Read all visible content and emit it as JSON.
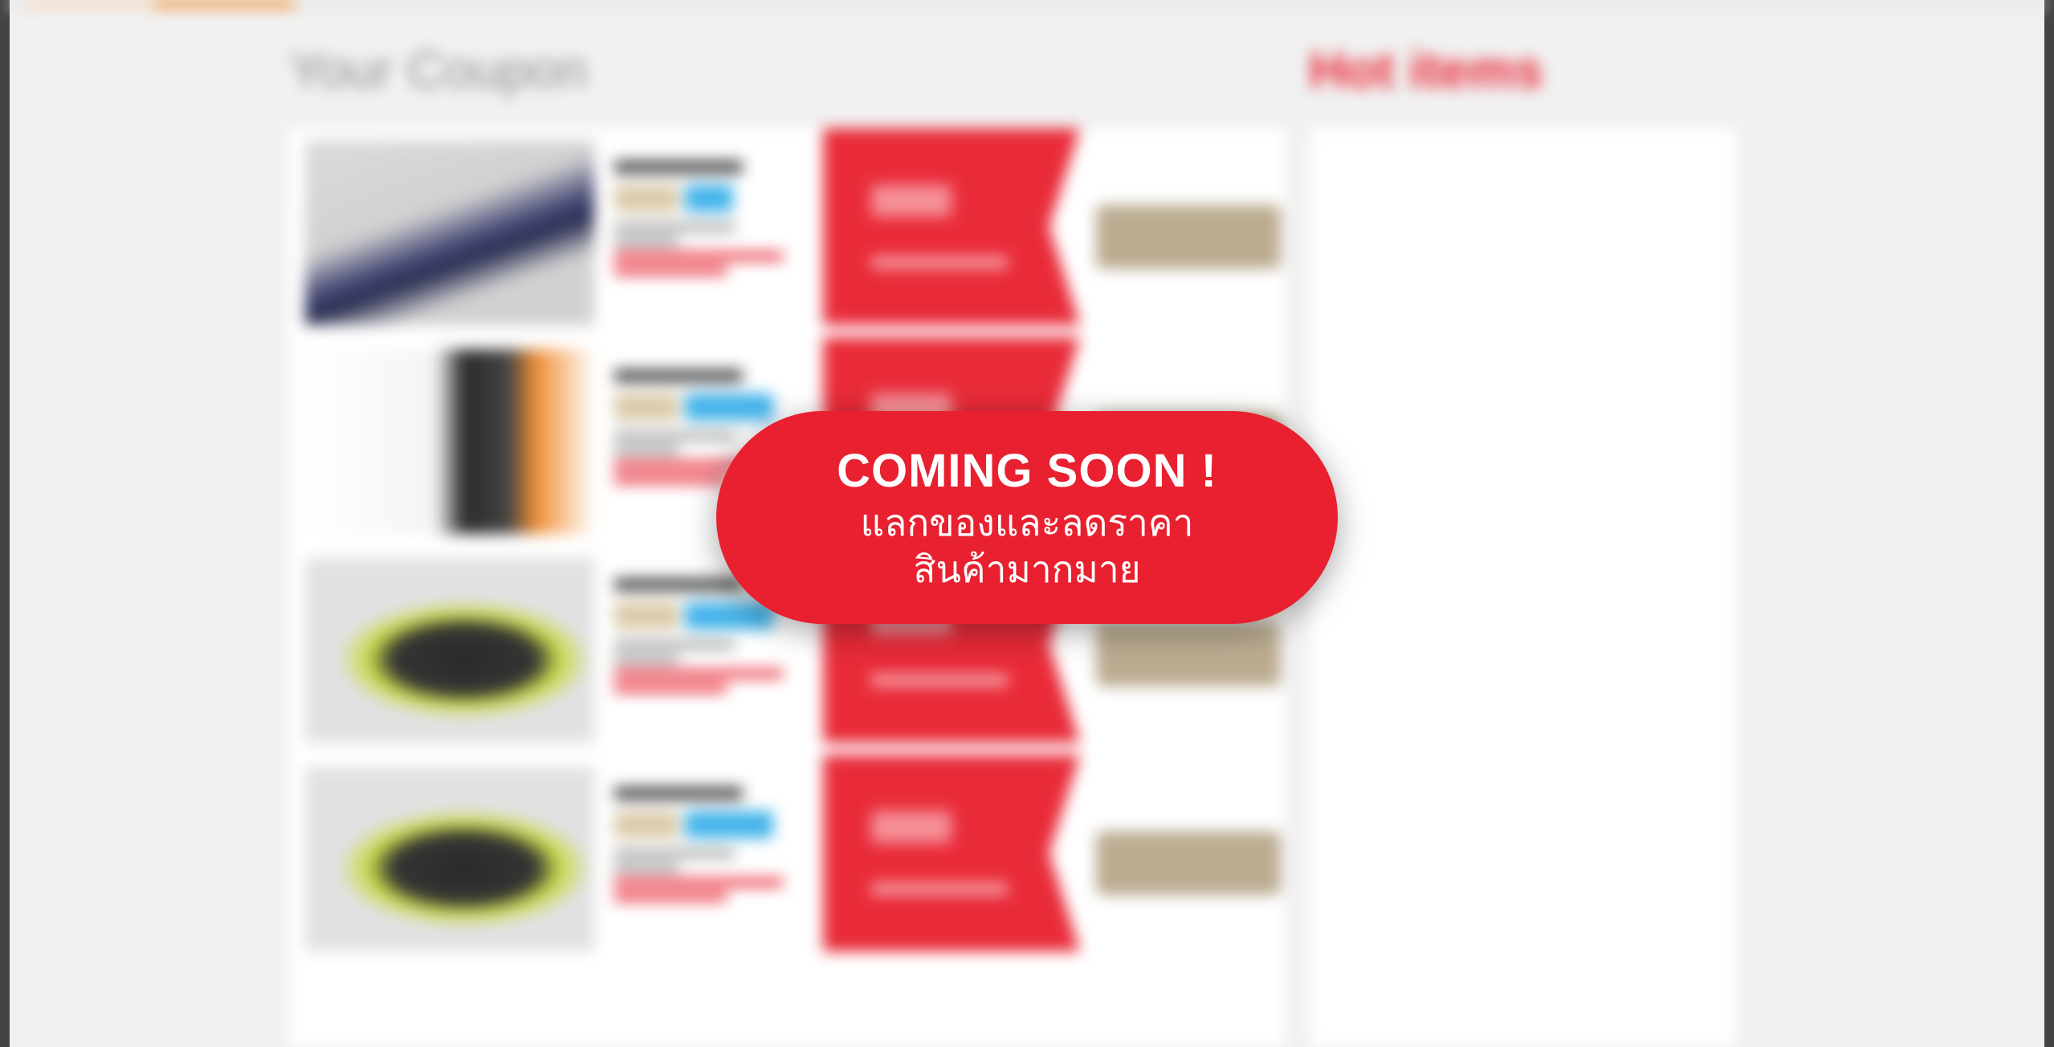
{
  "sections": {
    "coupon_title": "Your Coupon",
    "hot_title": "Hot items"
  },
  "coupons": [
    {
      "image": "racket-image"
    },
    {
      "image": "rackets-set-image"
    },
    {
      "image": "shoe-image"
    },
    {
      "image": "shoe-image"
    }
  ],
  "overlay": {
    "title": "COMING SOON !",
    "line1": "แลกของและลดราคา",
    "line2": "สินค้ามากมาย"
  },
  "colors": {
    "brand_red": "#e8202f",
    "redeem_button": "#b8a88c",
    "tag_blue": "#3ab0ea",
    "accent_orange": "#f08a2c"
  }
}
